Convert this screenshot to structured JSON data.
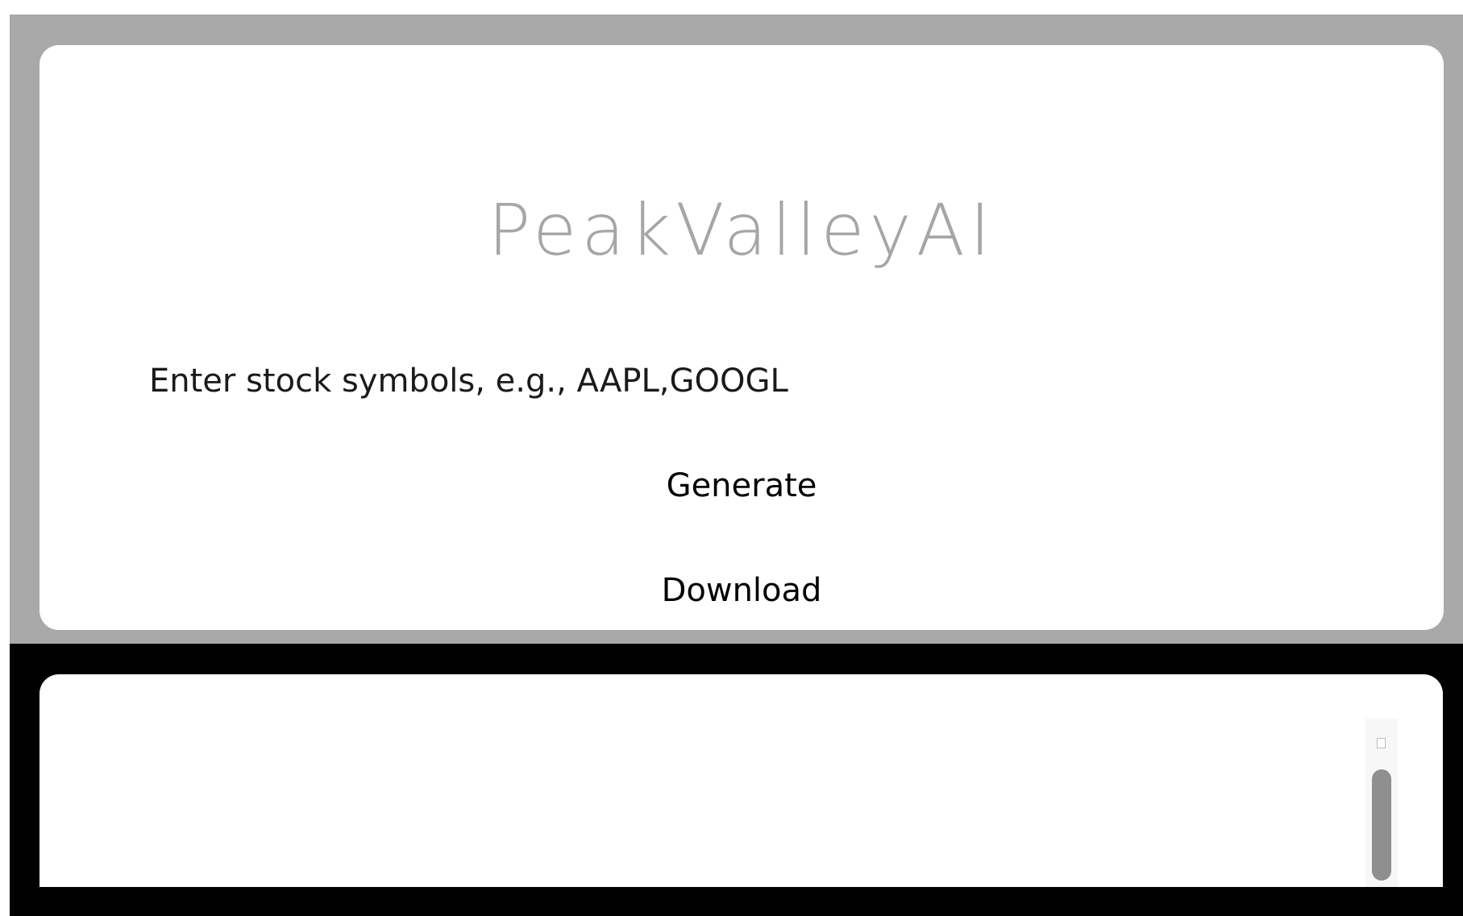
{
  "app": {
    "title": "PeakValleyAI"
  },
  "form": {
    "symbols_placeholder": "Enter stock symbols, e.g., AAPL,GOOGL",
    "symbols_value": "",
    "generate_label": "Generate",
    "download_label": "Download"
  },
  "colors": {
    "outer_top_bg": "#a9a9a9",
    "outer_bottom_bg": "#000000",
    "card_bg": "#ffffff",
    "title_color": "#a6a6a6",
    "scroll_thumb": "#8f8f8f"
  },
  "icons": {
    "scroll_up": "scroll-up-arrow-icon"
  }
}
